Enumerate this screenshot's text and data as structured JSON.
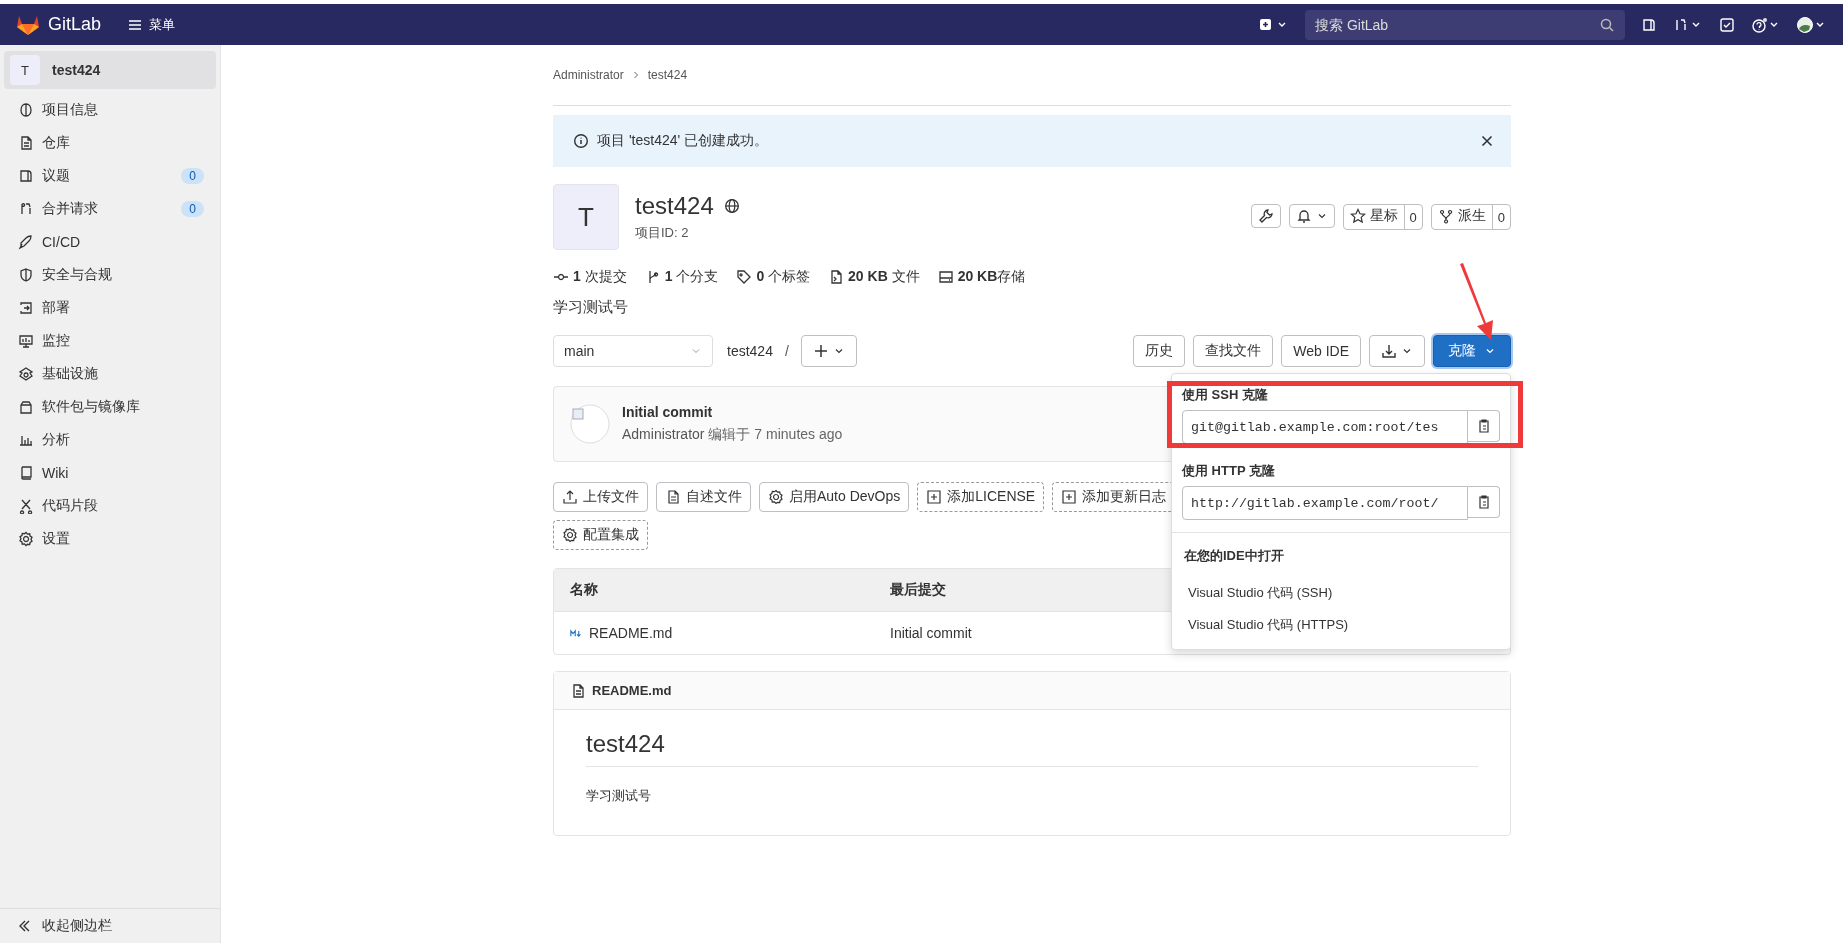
{
  "top_bar": {
    "logo": "GitLab",
    "menu": "菜单",
    "search": {
      "placeholder": "搜索 GitLab"
    }
  },
  "sidebar": {
    "project": {
      "avatar": "T",
      "name": "test424",
      "selected": true
    },
    "items": [
      {
        "label": "项目信息"
      },
      {
        "label": "仓库"
      },
      {
        "label": "议题",
        "count": "0"
      },
      {
        "label": "合并请求",
        "count": "0"
      },
      {
        "label": "CI/CD"
      },
      {
        "label": "安全与合规"
      },
      {
        "label": "部署"
      },
      {
        "label": "监控"
      },
      {
        "label": "基础设施"
      },
      {
        "label": "软件包与镜像库"
      },
      {
        "label": "分析"
      },
      {
        "label": "Wiki"
      },
      {
        "label": "代码片段"
      },
      {
        "label": "设置"
      }
    ],
    "collapse": "收起侧边栏"
  },
  "breadcrumb": [
    "Administrator",
    "test424"
  ],
  "alert": {
    "text": "项目 'test424' 已创建成功。"
  },
  "project": {
    "avatar": "T",
    "name": "test424",
    "id": "项目ID: 2",
    "star": {
      "label": "星标",
      "count": "0"
    },
    "fork": {
      "label": "派生",
      "count": "0"
    }
  },
  "stats": [
    "**1** 次提交",
    "**1** 个分支",
    "**0** 个标签",
    "**20 KB** 文件",
    "**20 KB**存储"
  ],
  "description": "学习测试号",
  "toolbar": {
    "branch": "main",
    "path": "test424",
    "separator": "/",
    "buttons": [
      "历史",
      "查找文件",
      "Web IDE"
    ],
    "clone": "克隆"
  },
  "commit": {
    "title": "Initial commit",
    "author": "Administrator",
    "meta": "编辑于 7 minutes ago"
  },
  "actions": [
    {
      "label": "上传文件",
      "kind": "solid"
    },
    {
      "label": "自述文件",
      "kind": "solid"
    },
    {
      "label": "启用Auto DevOps",
      "kind": "solid"
    },
    {
      "label": "添加LICENSE",
      "kind": "dashed"
    },
    {
      "label": "添加更新日志",
      "kind": "dashed"
    },
    {
      "label": "配置集成",
      "kind": "dashed"
    }
  ],
  "table": {
    "columns": [
      "名称",
      "最后提交"
    ],
    "rows": [
      {
        "name": "README.md",
        "last_commit": "Initial commit"
      }
    ]
  },
  "readme": {
    "file": "README.md",
    "heading": "test424",
    "body": "学习测试号"
  },
  "clone_dropdown": {
    "sections": [
      {
        "title": "使用 SSH 克隆",
        "url": "git@gitlab.example.com:root/tes"
      },
      {
        "title": "使用 HTTP 克隆",
        "url": "http://gitlab.example.com/root/"
      }
    ],
    "ide_title": "在您的IDE中打开",
    "ide_items": [
      "Visual Studio 代码 (SSH)",
      "Visual Studio 代码 (HTTPS)"
    ]
  }
}
